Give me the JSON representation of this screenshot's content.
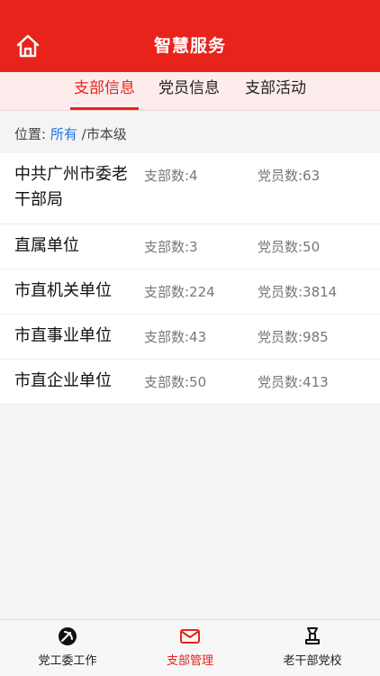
{
  "header": {
    "title": "智慧服务"
  },
  "tabs": [
    {
      "label": "支部信息",
      "active": true
    },
    {
      "label": "党员信息",
      "active": false
    },
    {
      "label": "支部活动",
      "active": false
    }
  ],
  "breadcrumb": {
    "prefix": "位置:",
    "link": "所有",
    "current": "/市本级"
  },
  "rows": [
    {
      "name": "中共广州市委老干部局",
      "branch": "支部数:4",
      "member": "党员数:63"
    },
    {
      "name": "直属单位",
      "branch": "支部数:3",
      "member": "党员数:50"
    },
    {
      "name": "市直机关单位",
      "branch": "支部数:224",
      "member": "党员数:3814"
    },
    {
      "name": "市直事业单位",
      "branch": "支部数:43",
      "member": "党员数:985"
    },
    {
      "name": "市直企业单位",
      "branch": "支部数:50",
      "member": "党员数:413"
    }
  ],
  "bottom_nav": [
    {
      "label": "党工委工作",
      "icon": "party-emblem-icon",
      "active": false
    },
    {
      "label": "支部管理",
      "icon": "mail-icon",
      "active": true
    },
    {
      "label": "老干部党校",
      "icon": "school-icon",
      "active": false
    }
  ],
  "colors": {
    "primary": "#e7231c",
    "tab_bg": "#fdecec",
    "link": "#1a73e8"
  }
}
